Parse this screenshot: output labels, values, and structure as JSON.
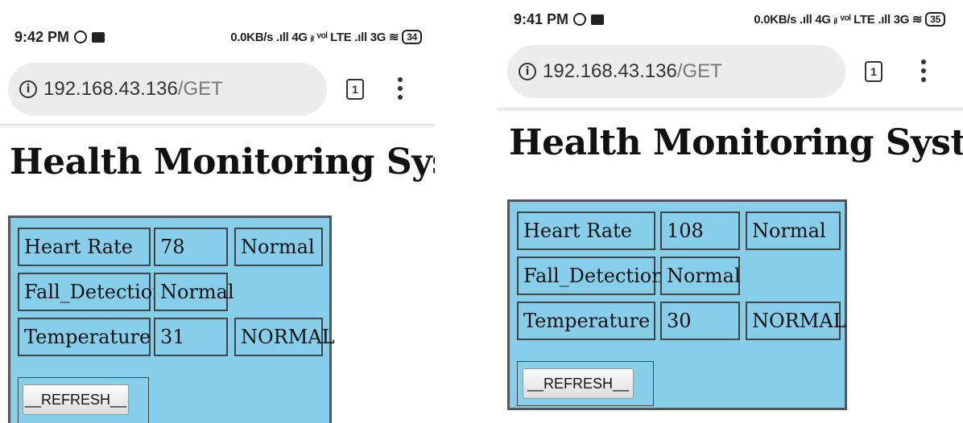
{
  "screens": [
    {
      "status": {
        "time": "9:42 PM",
        "network": "0.0KB/s .ıll 4G ᵢₗ ᵛᵒˡ LTE .ıll 3G ≋",
        "battery": "34"
      },
      "browser": {
        "info": "i",
        "url_host": "192.168.43.136",
        "url_path": "/GET",
        "tab_count": "1"
      },
      "title": "Health Monitoring System",
      "rows": [
        {
          "label": "Heart Rate",
          "value": "78",
          "status": "Normal"
        },
        {
          "label": "Fall_Detection",
          "value": "Normal",
          "status": ""
        },
        {
          "label": "Temperature",
          "value": "31",
          "status": "NORMAL"
        }
      ],
      "refresh_label": "__REFRESH__"
    },
    {
      "status": {
        "time": "9:41 PM",
        "network": "0.0KB/s .ıll 4G ᵢₗ ᵛᵒˡ LTE .ıll 3G ≋",
        "battery": "35"
      },
      "browser": {
        "info": "i",
        "url_host": "192.168.43.136",
        "url_path": "/GET",
        "tab_count": "1"
      },
      "title": "Health Monitoring System",
      "rows": [
        {
          "label": "Heart Rate",
          "value": "108",
          "status": "Normal"
        },
        {
          "label": "Fall_Detection",
          "value": "Normal",
          "status": ""
        },
        {
          "label": "Temperature",
          "value": "30",
          "status": "NORMAL"
        }
      ],
      "refresh_label": "__REFRESH__"
    }
  ],
  "colors": {
    "panel_bg": "#87ceeb",
    "panel_border": "#555555",
    "urlbar_bg": "#ececec"
  }
}
